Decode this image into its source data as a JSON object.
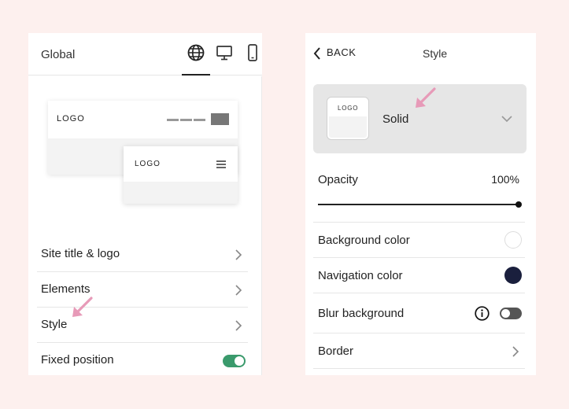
{
  "left_panel": {
    "title": "Global",
    "device_tabs": [
      {
        "name": "globe-icon",
        "active": true
      },
      {
        "name": "desktop-icon",
        "active": false
      },
      {
        "name": "mobile-icon",
        "active": false
      }
    ],
    "preview": {
      "desktop_logo": "LOGO",
      "mobile_logo": "LOGO"
    },
    "items": [
      {
        "label": "Site title & logo"
      },
      {
        "label": "Elements"
      },
      {
        "label": "Style"
      },
      {
        "label": "Fixed position",
        "toggle": true
      }
    ]
  },
  "right_panel": {
    "back_label": "BACK",
    "title": "Style",
    "style_select": {
      "thumb_logo": "LOGO",
      "value": "Solid"
    },
    "opacity": {
      "label": "Opacity",
      "value": "100%"
    },
    "rows": [
      {
        "label": "Background color",
        "swatch": "#ffffff"
      },
      {
        "label": "Navigation color",
        "swatch": "#1a1f3d"
      },
      {
        "label": "Blur background",
        "toggle": false
      },
      {
        "label": "Border"
      }
    ]
  },
  "colors": {
    "background": "#fdf0ee",
    "toggle_on": "#3a9a6c",
    "arrow": "#e79ab8"
  }
}
